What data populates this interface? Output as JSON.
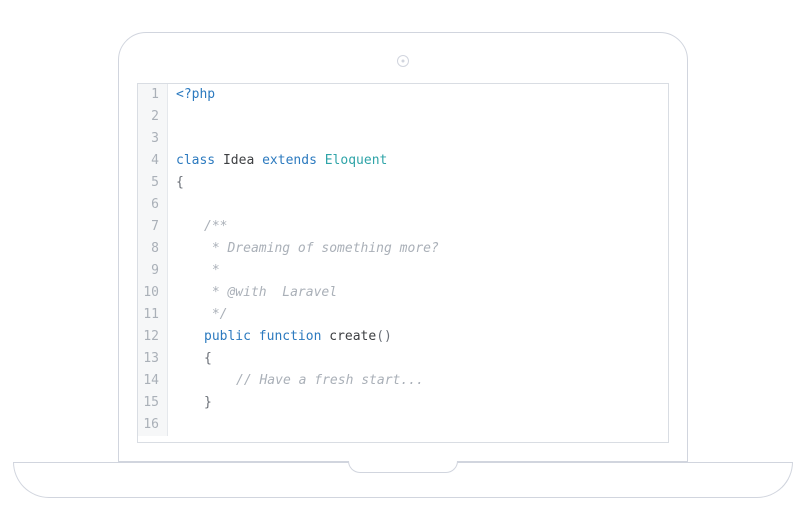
{
  "language": "php",
  "code": {
    "lines": [
      {
        "n": 1,
        "tokens": [
          {
            "t": "<?php",
            "c": "tok-keyword"
          }
        ]
      },
      {
        "n": 2,
        "tokens": []
      },
      {
        "n": 3,
        "tokens": []
      },
      {
        "n": 4,
        "tokens": [
          {
            "t": "class ",
            "c": "tok-keyword"
          },
          {
            "t": "Idea ",
            "c": "tok-func"
          },
          {
            "t": "extends ",
            "c": "tok-keyword"
          },
          {
            "t": "Eloquent",
            "c": "tok-builtin"
          }
        ]
      },
      {
        "n": 5,
        "tokens": [
          {
            "t": "{",
            "c": "tok-punct"
          }
        ]
      },
      {
        "n": 6,
        "tokens": []
      },
      {
        "n": 7,
        "indent": "indent1",
        "tokens": [
          {
            "t": "/**",
            "c": "tok-comment"
          }
        ]
      },
      {
        "n": 8,
        "indent": "indent1",
        "tokens": [
          {
            "t": " * Dreaming of something more?",
            "c": "tok-comment"
          }
        ]
      },
      {
        "n": 9,
        "indent": "indent1",
        "tokens": [
          {
            "t": " *",
            "c": "tok-comment"
          }
        ]
      },
      {
        "n": 10,
        "indent": "indent1",
        "tokens": [
          {
            "t": " * @with  Laravel",
            "c": "tok-comment"
          }
        ]
      },
      {
        "n": 11,
        "indent": "indent1",
        "tokens": [
          {
            "t": " */",
            "c": "tok-comment"
          }
        ]
      },
      {
        "n": 12,
        "indent": "indent1",
        "tokens": [
          {
            "t": "public ",
            "c": "tok-keyword"
          },
          {
            "t": "function ",
            "c": "tok-keyword"
          },
          {
            "t": "create",
            "c": "tok-method"
          },
          {
            "t": "()",
            "c": "tok-punct"
          }
        ]
      },
      {
        "n": 13,
        "indent": "indent1",
        "tokens": [
          {
            "t": "{",
            "c": "tok-punct"
          }
        ]
      },
      {
        "n": 14,
        "indent": "indent2b",
        "tokens": [
          {
            "t": "// Have a fresh start...",
            "c": "tok-comment"
          }
        ]
      },
      {
        "n": 15,
        "indent": "indent1",
        "tokens": [
          {
            "t": "}",
            "c": "tok-punct"
          }
        ]
      },
      {
        "n": 16,
        "tokens": []
      }
    ]
  }
}
